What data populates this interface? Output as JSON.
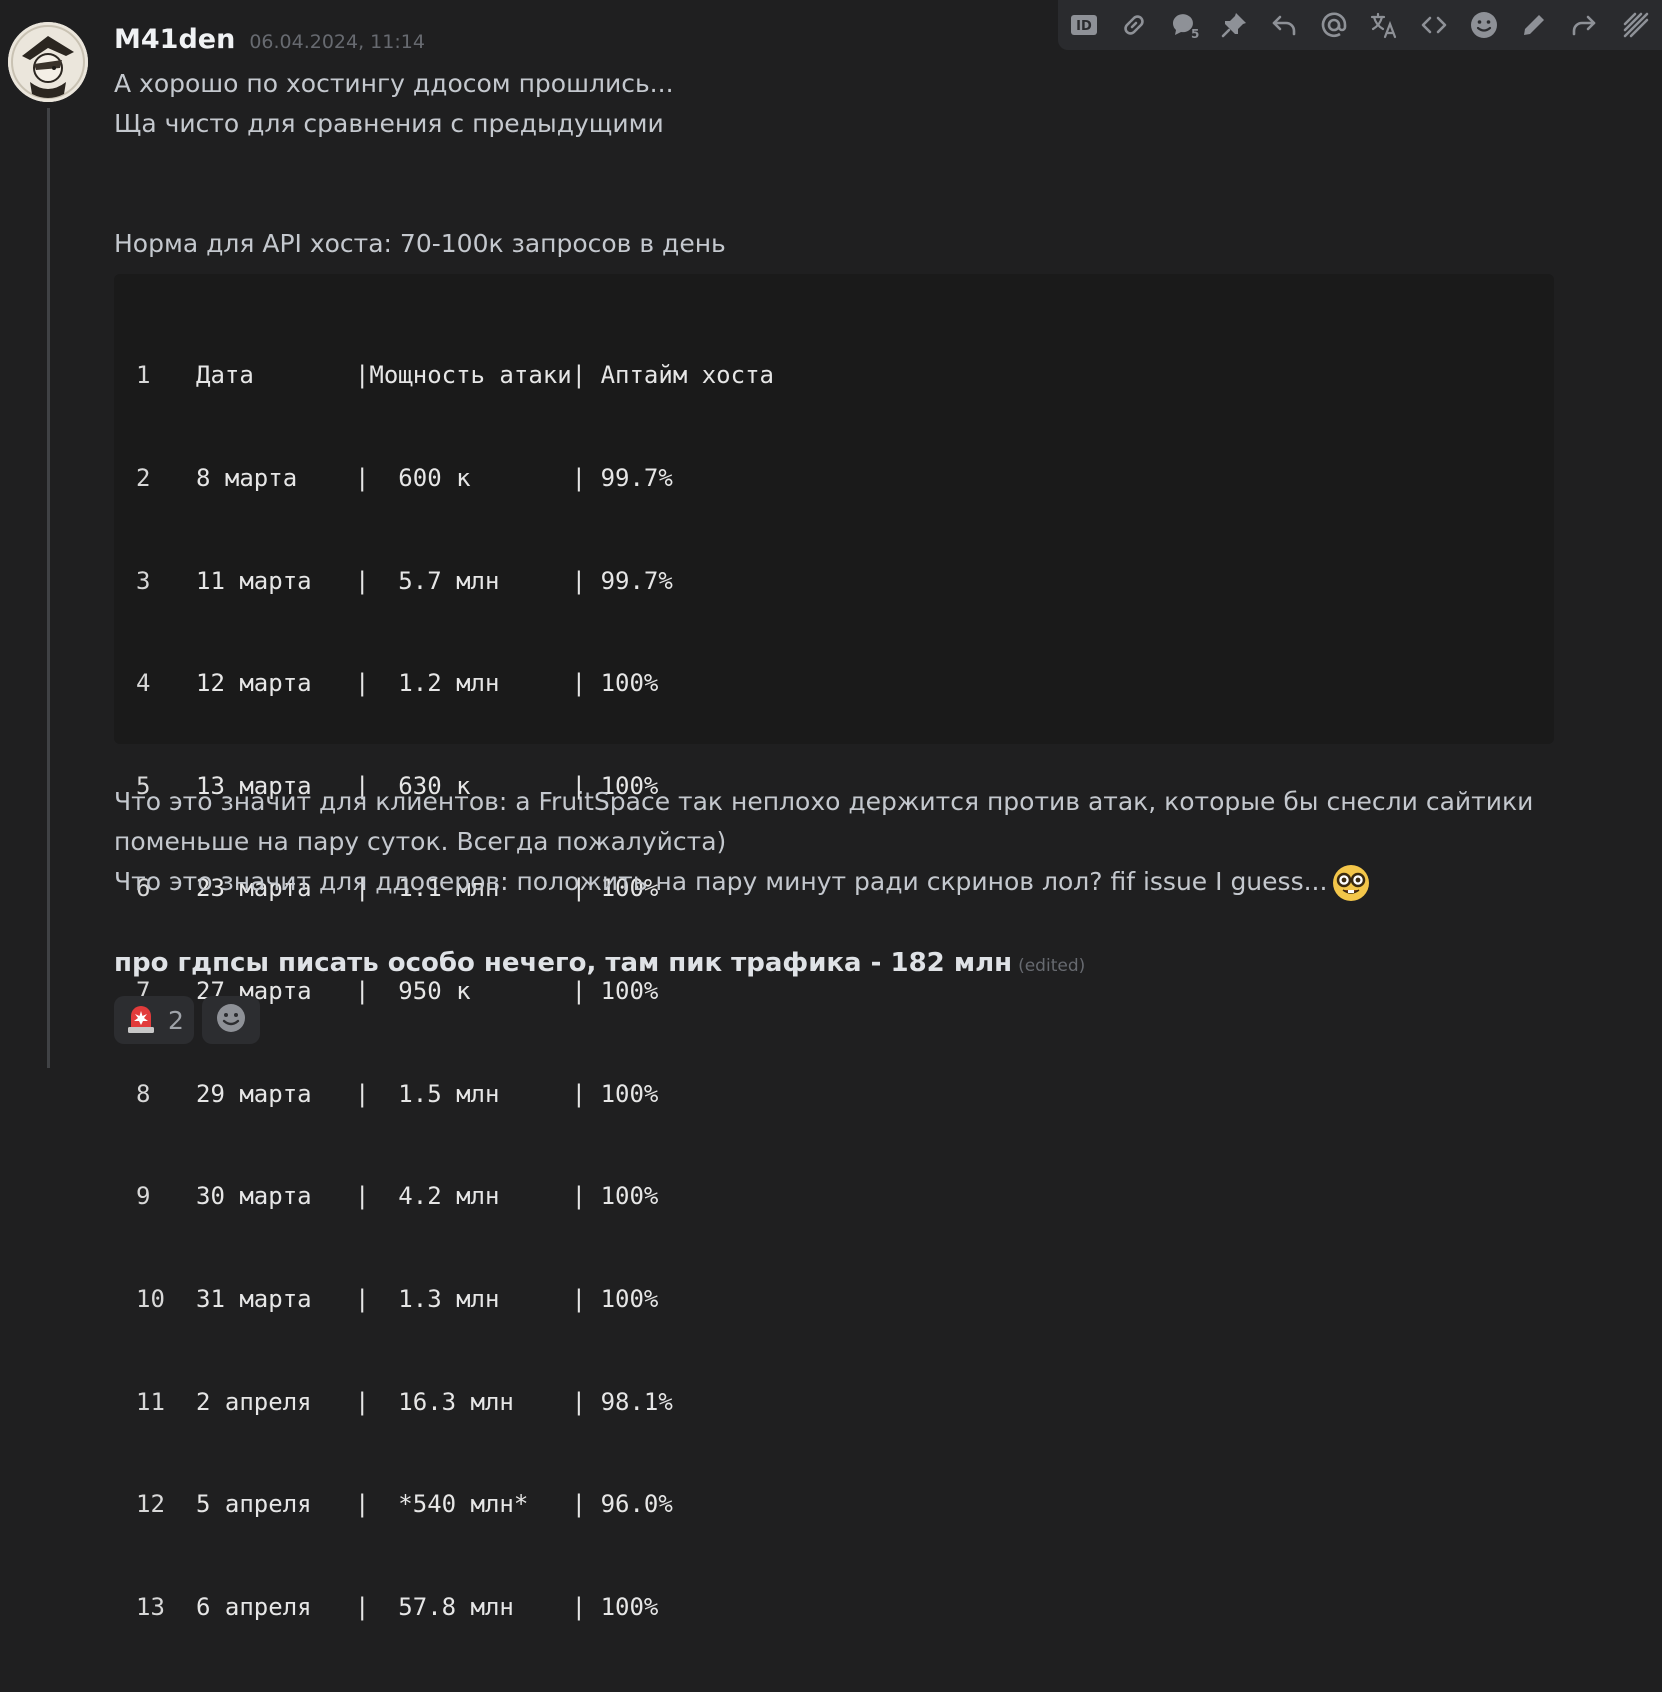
{
  "message": {
    "username": "M41den",
    "timestamp": "06.04.2024, 11:14",
    "lines": [
      "А хорошо по хостингу ддосом прошлись...",
      "Ща чисто для сравнения с предыдущими"
    ],
    "norm_line": "Норма для API хоста: 70-100к запросов в день",
    "code": [
      {
        "n": "1",
        "text": "Дата       |Мощность атаки| Аптайм хоста"
      },
      {
        "n": "2",
        "text": "8 марта    |  600 к       | 99.7%"
      },
      {
        "n": "3",
        "text": "11 марта   |  5.7 млн     | 99.7%"
      },
      {
        "n": "4",
        "text": "12 марта   |  1.2 млн     | 100%"
      },
      {
        "n": "5",
        "text": "13 марта   |  630 к       | 100%"
      },
      {
        "n": "6",
        "text": "23 марта   |  1.1 млн     | 100%"
      },
      {
        "n": "7",
        "text": "27 марта   |  950 к       | 100%"
      },
      {
        "n": "8",
        "text": "29 марта   |  1.5 млн     | 100%"
      },
      {
        "n": "9",
        "text": "30 марта   |  4.2 млн     | 100%"
      },
      {
        "n": "10",
        "text": "31 марта   |  1.3 млн     | 100%"
      },
      {
        "n": "11",
        "text": "2 апреля   |  16.3 млн    | 98.1%"
      },
      {
        "n": "12",
        "text": "5 апреля   |  *540 млн*   | 96.0%"
      },
      {
        "n": "13",
        "text": "6 апреля   |  57.8 млн    | 100%"
      }
    ],
    "clients_line": "Что это значит для клиентов: а FruitSpace так неплохо держится против атак, которые бы снесли сайтики поменьше на пару суток. Всегда пожалуйста)",
    "ddosers_line": "Что это значит для ддосеров: положить на пару минут ради скринов лол? fif issue I guess...",
    "bold_line": "про гдпсы писать особо нечего, там пик трафика - 182 млн",
    "edited_label": "(edited)"
  },
  "reactions": [
    {
      "icon": "siren-emoji",
      "count": "2"
    },
    {
      "icon": "add-reaction-icon",
      "count": ""
    }
  ],
  "toolbar": {
    "items": [
      "id-icon",
      "link-icon",
      "thread-icon",
      "pin-icon",
      "reply-icon",
      "mention-icon",
      "translate-icon",
      "code-icon",
      "emoji-icon",
      "edit-icon",
      "forward-icon",
      "more-icon"
    ]
  },
  "colors": {
    "background": "#1f1f20",
    "codeblock": "#1a1a1a",
    "toolbar": "#2a2b2e",
    "reaction": "#2c2d30"
  }
}
